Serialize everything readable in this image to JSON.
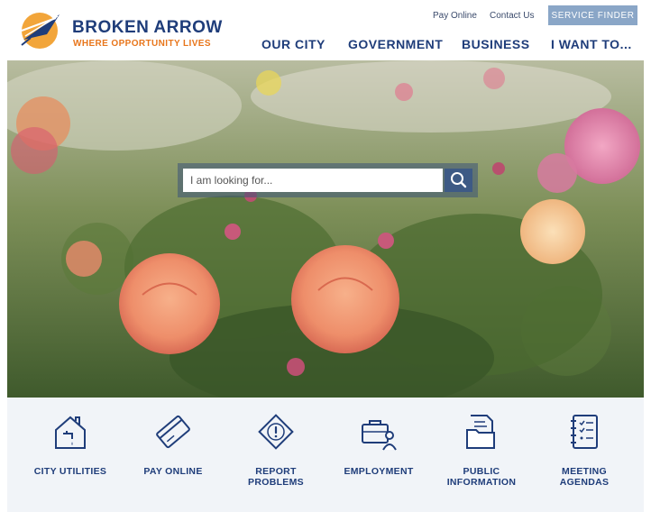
{
  "brand": {
    "name": "BROKEN ARROW",
    "tagline": "WHERE OPPORTUNITY LIVES"
  },
  "utility": {
    "pay_online": "Pay Online",
    "contact_us": "Contact Us",
    "service_finder": "SERVICE FINDER"
  },
  "nav": {
    "items": [
      {
        "label": "OUR CITY"
      },
      {
        "label": "GOVERNMENT"
      },
      {
        "label": "BUSINESS"
      },
      {
        "label": "I WANT TO..."
      }
    ]
  },
  "search": {
    "placeholder": "I am looking for..."
  },
  "quick_links": [
    {
      "label": "CITY UTILITIES",
      "icon": "house-faucet-icon"
    },
    {
      "label": "PAY ONLINE",
      "icon": "credit-card-icon"
    },
    {
      "label": "REPORT\nPROBLEMS",
      "icon": "warning-icon"
    },
    {
      "label": "EMPLOYMENT",
      "icon": "briefcase-person-icon"
    },
    {
      "label": "PUBLIC\nINFORMATION",
      "icon": "document-folder-icon"
    },
    {
      "label": "MEETING\nAGENDAS",
      "icon": "notebook-list-icon"
    }
  ],
  "colors": {
    "brand_blue": "#1f3d7a",
    "brand_orange": "#e8761c",
    "service_finder_bg": "#8aa6c7",
    "search_button_bg": "#3d5a85",
    "quicklinks_bg": "#f1f4f8"
  }
}
